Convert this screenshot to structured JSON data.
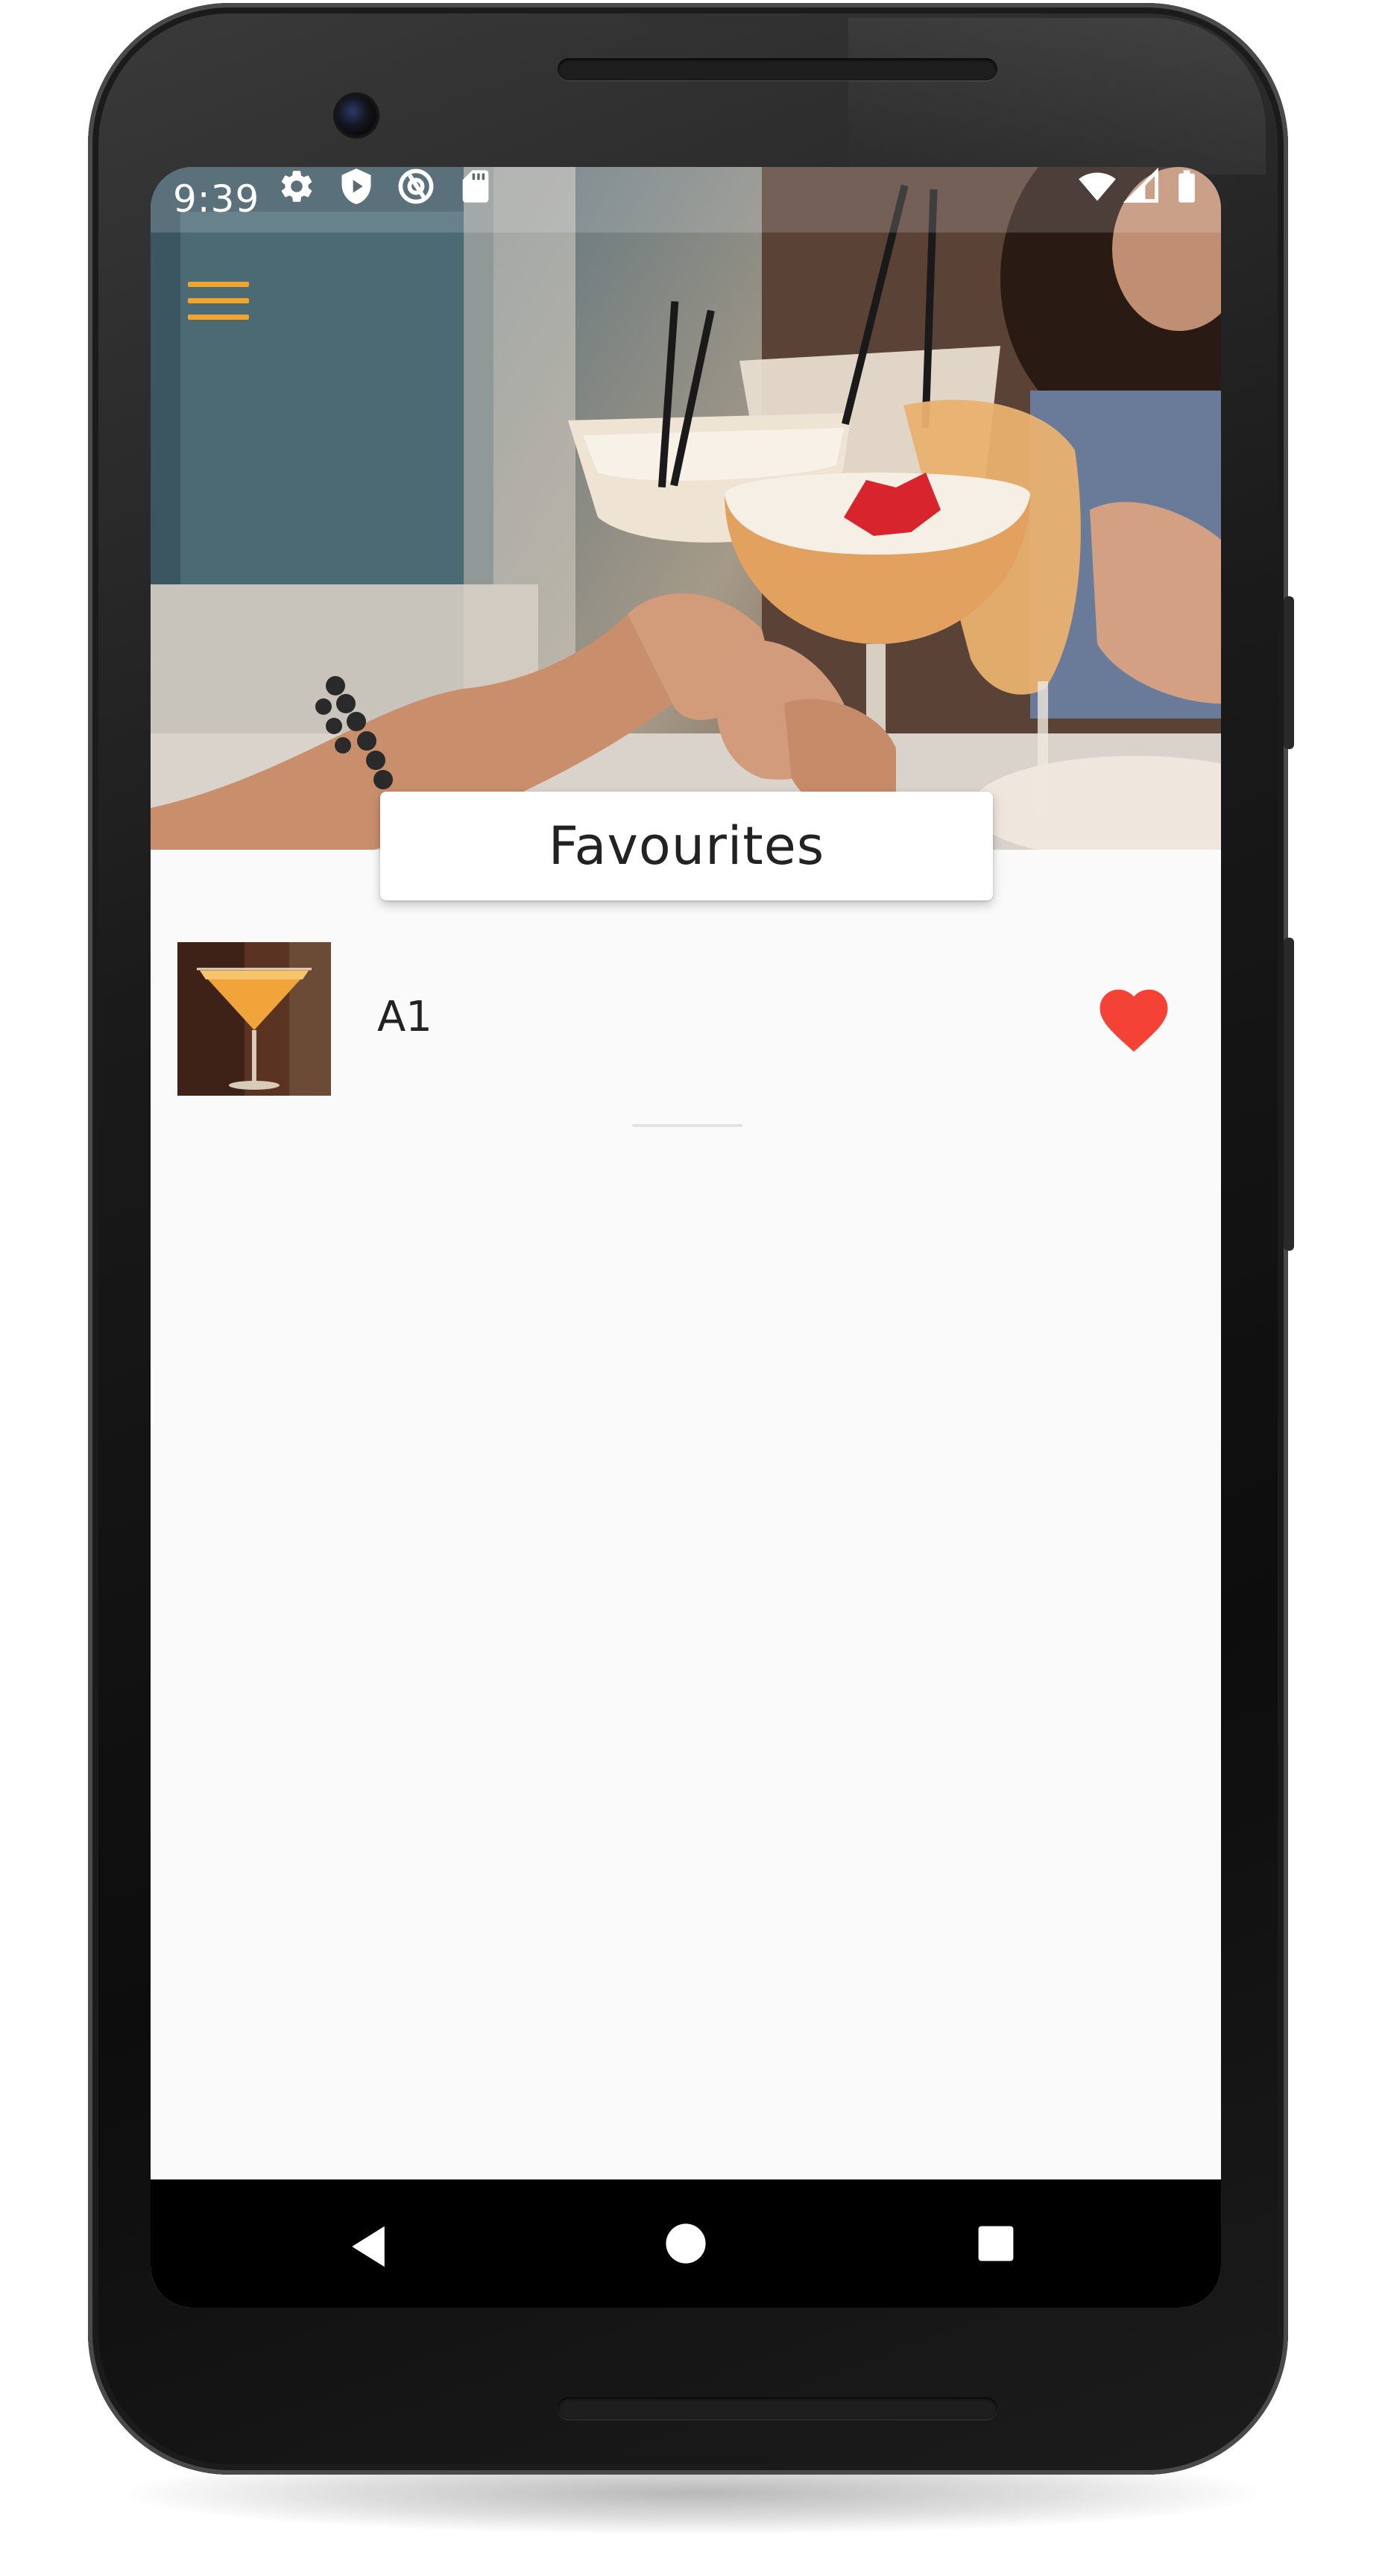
{
  "status_bar": {
    "time": "9:39",
    "left_icons": [
      "gear-icon",
      "shield-play-icon",
      "at-sign-icon",
      "sd-card-icon"
    ],
    "right_icons": [
      "wifi-icon",
      "cellular-signal-icon",
      "battery-icon"
    ]
  },
  "header": {
    "menu_icon": "hamburger-menu-icon",
    "menu_color": "#f2a42c",
    "hero_image": "friends toasting cocktails"
  },
  "page": {
    "title": "Favourites"
  },
  "favourites": [
    {
      "name": "A1",
      "thumbnail": "orange cocktail in martini glass",
      "favourite": true,
      "heart_icon": "heart-filled-icon",
      "heart_color": "#f44336"
    }
  ],
  "navigation": {
    "back_icon": "triangle-back-icon",
    "home_icon": "circle-home-icon",
    "recents_icon": "square-recents-icon"
  }
}
